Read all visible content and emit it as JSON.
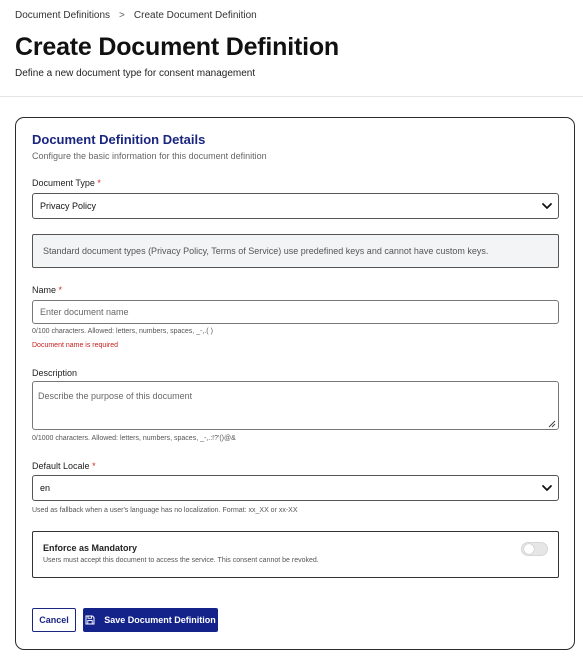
{
  "breadcrumb": {
    "parent": "Document Definitions",
    "separator": ">",
    "current": "Create Document Definition"
  },
  "header": {
    "title": "Create Document Definition",
    "subtitle": "Define a new document type for consent management"
  },
  "card": {
    "title": "Document Definition Details",
    "description": "Configure the basic information for this document definition"
  },
  "document_type": {
    "label": "Document Type",
    "required_mark": "*",
    "selected": "Privacy Policy",
    "info": "Standard document types (Privacy Policy, Terms of Service) use predefined keys and cannot have custom keys."
  },
  "name": {
    "label": "Name",
    "required_mark": "*",
    "value": "",
    "placeholder": "Enter document name",
    "helper": "0/100 characters. Allowed: letters, numbers, spaces, _-,.( )",
    "error": "Document name is required"
  },
  "description": {
    "label": "Description",
    "value": "",
    "placeholder": "Describe the purpose of this document",
    "helper": "0/1000 characters. Allowed: letters, numbers, spaces, _-,.:!?'()@&"
  },
  "default_locale": {
    "label": "Default Locale",
    "required_mark": "*",
    "selected": "en",
    "helper": "Used as fallback when a user's language has no localization. Format: xx_XX or xx-XX"
  },
  "mandatory": {
    "title": "Enforce as Mandatory",
    "description": "Users must accept this document to access the service. This consent cannot be revoked.",
    "enabled": false
  },
  "actions": {
    "cancel_label": "Cancel",
    "save_label": "Save Document Definition"
  },
  "colors": {
    "primary": "#14238a",
    "error": "#c62020",
    "required": "#d42a2a"
  },
  "icons": {
    "breadcrumb_separator": "chevron-right-icon",
    "select_chevron": "chevron-down-icon",
    "save": "save-icon"
  }
}
